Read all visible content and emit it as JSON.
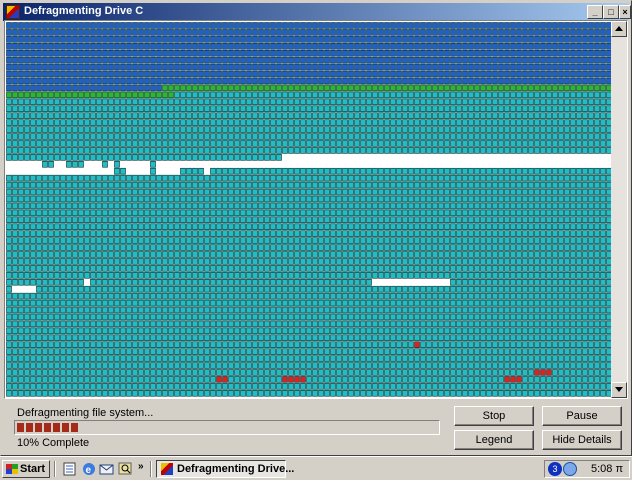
{
  "window": {
    "title": "Defragmenting Drive C",
    "controls": {
      "minimize": "_",
      "maximize": "□",
      "close": "×"
    }
  },
  "disk_map": {
    "legend_colors": {
      "fragmented": "#e02020",
      "contiguous": "#1fbdc5",
      "system": "#1f5fd0",
      "optimized": "#2cb82c",
      "free": "#ffffff"
    }
  },
  "status": {
    "message": "Defragmenting file system...",
    "percent_text": "10% Complete",
    "progress": 0.1
  },
  "buttons": {
    "stop": "Stop",
    "pause": "Pause",
    "legend": "Legend",
    "hide_details": "Hide Details"
  },
  "taskbar": {
    "start_label": "Start",
    "more": "»",
    "task_label": "Defragmenting Drive...",
    "tray_number": "3",
    "clock": "5:08 π"
  }
}
